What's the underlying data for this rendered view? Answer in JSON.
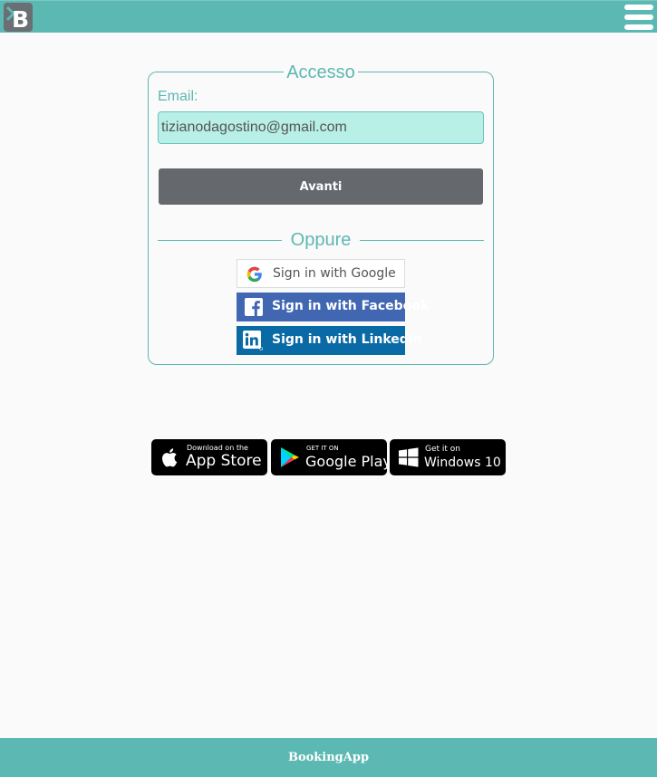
{
  "header": {
    "logo_icon": "bookingapp-logo-icon",
    "menu_icon": "hamburger-menu-icon"
  },
  "login": {
    "legend": "Accesso",
    "email_label": "Email:",
    "email_value": "tizianodagostino@gmail.com",
    "next_button": "Avanti",
    "separator": "Oppure",
    "social": {
      "google": "Sign in with Google",
      "facebook": "Sign in with Facebook",
      "linkedin": "Sign in with Linkedin"
    }
  },
  "stores": [
    {
      "small": "Download on the",
      "big": "App Store",
      "icon": "apple-icon"
    },
    {
      "small": "GET IT ON",
      "big": "Google Play",
      "icon": "google-play-icon"
    },
    {
      "small": "Get it on",
      "big": "Windows 10",
      "icon": "windows-icon"
    }
  ],
  "footer": {
    "text": "BookingApp"
  },
  "colors": {
    "brand": "#5cb8b2",
    "input_bg": "#b8efe6",
    "button_dark": "#65686d",
    "facebook": "#4267b2",
    "linkedin": "#0a6aa5"
  }
}
